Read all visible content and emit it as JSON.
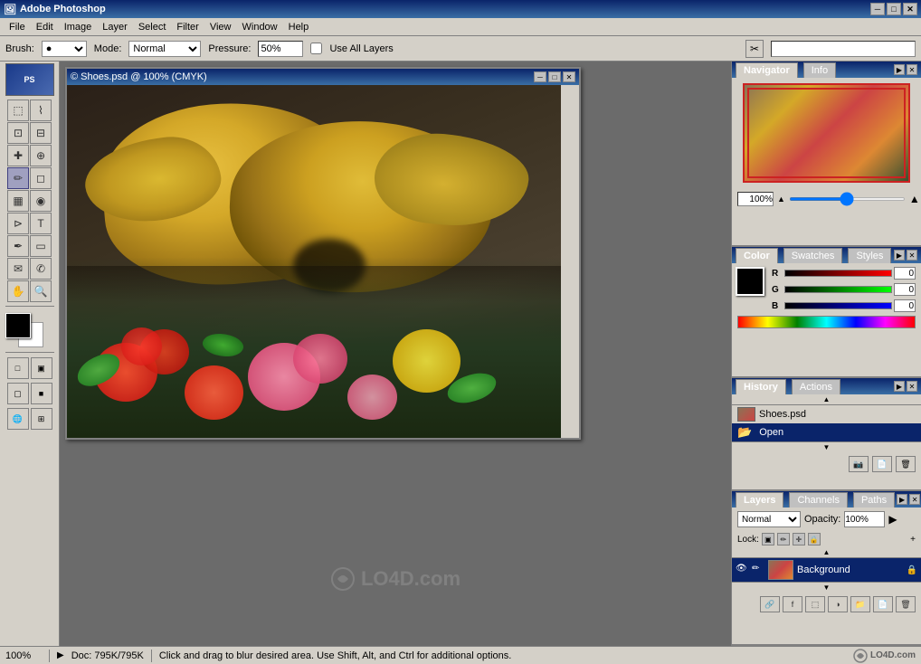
{
  "app": {
    "title": "Adobe Photoshop",
    "title_icon": "🖼"
  },
  "title_bar": {
    "minimize": "─",
    "maximize": "□",
    "close": "✕"
  },
  "menu": {
    "items": [
      "File",
      "Edit",
      "Image",
      "Layer",
      "Select",
      "Filter",
      "View",
      "Window",
      "Help"
    ]
  },
  "options_bar": {
    "brush_label": "Brush:",
    "mode_label": "Mode:",
    "mode_value": "Normal",
    "pressure_label": "Pressure:",
    "pressure_value": "50%",
    "use_all_layers": "Use All Layers"
  },
  "document": {
    "title": "© Shoes.psd @ 100% (CMYK)"
  },
  "navigator": {
    "tab_active": "Navigator",
    "tab_info": "Info",
    "zoom_value": "100%"
  },
  "color": {
    "tab_active": "Color",
    "tab_swatches": "Swatches",
    "tab_styles": "Styles",
    "r_value": "0",
    "g_value": "0",
    "b_value": "0"
  },
  "history": {
    "tab_active": "History",
    "tab_actions": "Actions",
    "items": [
      {
        "name": "Shoes.psd",
        "type": "file"
      },
      {
        "name": "Open",
        "type": "action",
        "active": true
      }
    ]
  },
  "layers": {
    "tab_active": "Layers",
    "tab_channels": "Channels",
    "tab_paths": "Paths",
    "blend_mode": "Normal",
    "opacity_label": "Opacity:",
    "opacity_value": "100%",
    "lock_label": "Lock:",
    "items": [
      {
        "name": "Background",
        "visible": true,
        "locked": true
      }
    ]
  },
  "status_bar": {
    "zoom": "100%",
    "doc_size": "Doc: 795K/795K",
    "message": "Click and drag to blur desired area. Use Shift, Alt, and Ctrl for additional options."
  },
  "tools": [
    [
      "marquee",
      "lasso"
    ],
    [
      "crop",
      "slice"
    ],
    [
      "heal",
      "stamp"
    ],
    [
      "brush",
      "eraser"
    ],
    [
      "gradient",
      "blur"
    ],
    [
      "path",
      "text"
    ],
    [
      "pen",
      "shape"
    ],
    [
      "annotate",
      "eyedrop"
    ],
    [
      "hand",
      "zoom"
    ]
  ]
}
